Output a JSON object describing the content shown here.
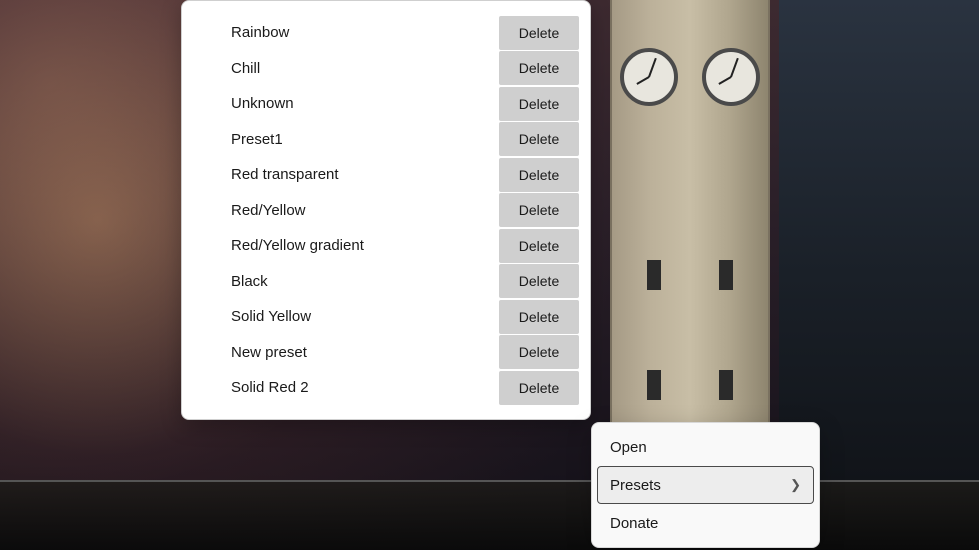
{
  "presets": [
    {
      "name": "Rainbow",
      "action": "Delete"
    },
    {
      "name": "Chill",
      "action": "Delete"
    },
    {
      "name": "Unknown",
      "action": "Delete"
    },
    {
      "name": "Preset1",
      "action": "Delete"
    },
    {
      "name": "Red transparent",
      "action": "Delete"
    },
    {
      "name": "Red/Yellow",
      "action": "Delete"
    },
    {
      "name": "Red/Yellow gradient",
      "action": "Delete"
    },
    {
      "name": "Black",
      "action": "Delete"
    },
    {
      "name": "Solid Yellow",
      "action": "Delete"
    },
    {
      "name": "New preset",
      "action": "Delete"
    },
    {
      "name": "Solid Red 2",
      "action": "Delete"
    }
  ],
  "context_menu": {
    "items": [
      {
        "label": "Open",
        "has_submenu": false,
        "highlighted": false
      },
      {
        "label": "Presets",
        "has_submenu": true,
        "highlighted": true
      },
      {
        "label": "Donate",
        "has_submenu": false,
        "highlighted": false
      }
    ]
  }
}
